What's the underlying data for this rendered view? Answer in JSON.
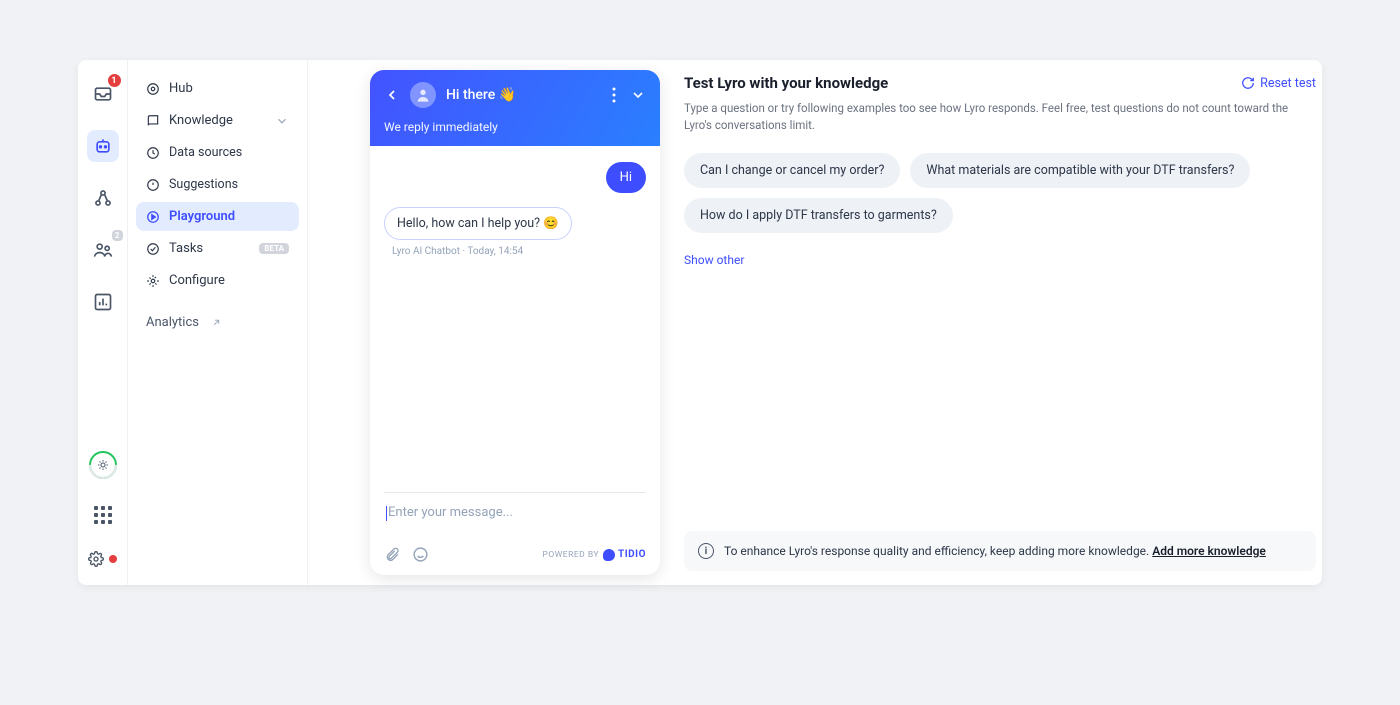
{
  "rail": {
    "inbox_badge": "1",
    "people_badge": "2"
  },
  "sidebar": {
    "hub": "Hub",
    "knowledge": "Knowledge",
    "data_sources": "Data sources",
    "suggestions": "Suggestions",
    "playground": "Playground",
    "tasks": "Tasks",
    "tasks_badge": "BETA",
    "configure": "Configure",
    "analytics": "Analytics"
  },
  "chat": {
    "greeting": "Hi there 👋",
    "subtitle": "We reply immediately",
    "user_msg": "Hi",
    "bot_msg": "Hello, how can I help you? 😊",
    "bot_meta": "Lyro AI Chatbot · Today, 14:54",
    "input_placeholder": "Enter your message...",
    "powered_by": "POWERED BY",
    "brand": "TIDIO"
  },
  "panel": {
    "title": "Test Lyro with your knowledge",
    "reset": "Reset test",
    "description": "Type a question or try following examples too see how Lyro responds. Feel free, test questions do not count toward the Lyro's conversations limit.",
    "questions": [
      "Can I change or cancel my order?",
      "What materials are compatible with your DTF transfers?",
      "How do I apply DTF transfers to garments?"
    ],
    "show_other": "Show other",
    "banner_text": "To enhance Lyro's response quality and efficiency, keep adding more knowledge. ",
    "banner_link": "Add more knowledge"
  }
}
